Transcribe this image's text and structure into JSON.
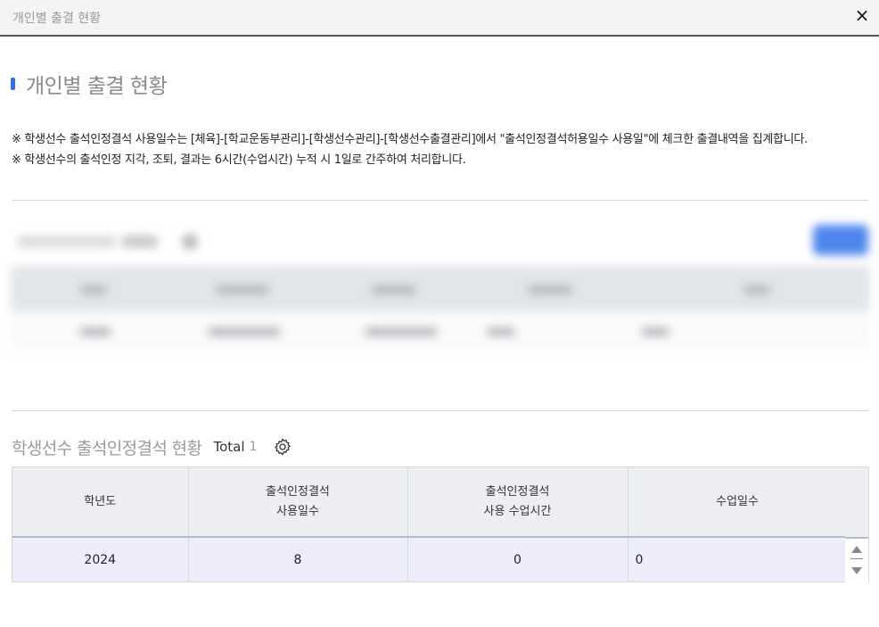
{
  "window": {
    "title": "개인별 출결 현황",
    "close_label": "×"
  },
  "section": {
    "title": "개인별 출결 현황",
    "accent_color": "#2f6df0"
  },
  "notice": {
    "lines": [
      "※ 학생선수 출석인정결석 사용일수는 [체육]-[학교운동부관리]-[학생선수관리]-[학생선수출결관리]에서 \"출석인정결석허용일수 사용일\"에 체크한 출결내역을 집계합니다.",
      "※ 학생선수의 출석인정 지각, 조퇴, 결과는 6시간(수업시간) 누적 시 1일로 간주하여 처리합니다."
    ]
  },
  "attendance_grid": {
    "title": "학생선수 출석인정결석 현황",
    "total_label": "Total",
    "total_count": "1",
    "settings_icon": "gear-icon",
    "columns": [
      {
        "line1": "학년도",
        "line2": ""
      },
      {
        "line1": "출석인정결석",
        "line2": "사용일수"
      },
      {
        "line1": "출석인정결석",
        "line2": "사용 수업시간"
      },
      {
        "line1": "수업일수",
        "line2": ""
      }
    ],
    "rows": [
      {
        "year": "2024",
        "used_days": "8",
        "used_hours": "0",
        "class_days": "0"
      }
    ],
    "selected_row_color": "#edecfa"
  }
}
